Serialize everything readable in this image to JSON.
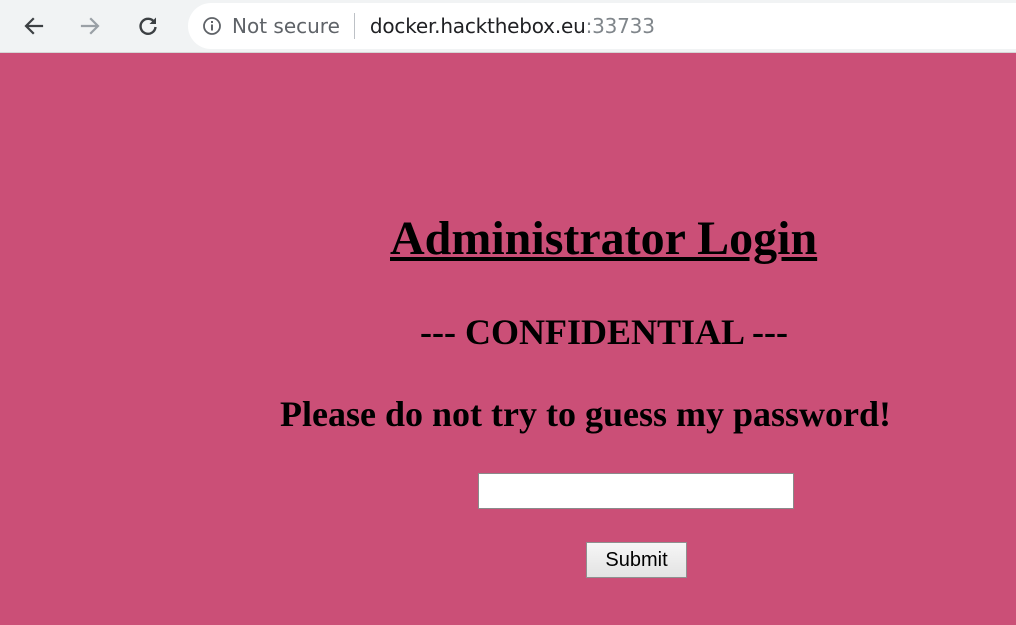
{
  "browser": {
    "security_label": "Not secure",
    "url_host": "docker.hackthebox.eu",
    "url_port": ":33733",
    "icons": {
      "back": "arrow-left-icon",
      "forward": "arrow-right-icon",
      "reload": "reload-icon",
      "info": "info-icon"
    }
  },
  "page": {
    "background_color": "#cb4f77",
    "title": "Administrator Login",
    "confidential": "--- CONFIDENTIAL ---",
    "warning": "Please do not try to guess my password!",
    "password_value": "",
    "submit_label": "Submit"
  }
}
